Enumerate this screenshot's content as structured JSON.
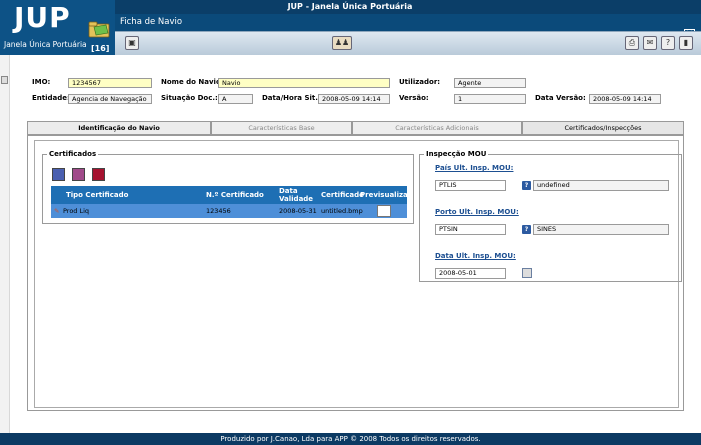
{
  "header": {
    "logo": "JUP",
    "logo_subtitle": "Janela Única Portuária",
    "inbox_count": "[16]",
    "app_title": "JUP - Janela Única Portuária",
    "form_title": "Ficha de Navio"
  },
  "fields": {
    "imo": {
      "label": "IMO:",
      "value": "1234567"
    },
    "nome_navio": {
      "label": "Nome do Navio:",
      "value": "Navio"
    },
    "utilizador": {
      "label": "Utilizador:",
      "value": "Agente"
    },
    "entidade": {
      "label": "Entidade:",
      "value": "Agencia de Navegação"
    },
    "situacao_doc": {
      "label": "Situação Doc.:",
      "value": "A"
    },
    "data_hora_sit": {
      "label": "Data/Hora Sit.:",
      "value": "2008-05-09 14:14"
    },
    "versao": {
      "label": "Versão:",
      "value": "1"
    },
    "data_versao": {
      "label": "Data Versão:",
      "value": "2008-05-09 14:14"
    }
  },
  "tabs": [
    {
      "label": "Identificação do Navio"
    },
    {
      "label": "Características Base"
    },
    {
      "label": "Características Adicionais"
    },
    {
      "label": "Certificados/Inspecções"
    }
  ],
  "certificados": {
    "legend": "Certificados",
    "columns": [
      "Tipo Certificado",
      "N.º Certificado",
      "Data Validade",
      "Certificado",
      "Previsualizar"
    ],
    "rows": [
      {
        "tipo": "Prod Liq",
        "numero": "123456",
        "validade": "2008-05-31",
        "certificado": "untitled.bmp"
      }
    ]
  },
  "inspeccao": {
    "legend": "Inspecção MOU",
    "pais_label": "País Ult. Insp. MOU:",
    "pais_code": "PTLIS",
    "pais_desc": "undefined",
    "porto_label": "Porto Ult. Insp. MOU:",
    "porto_code": "PTSIN",
    "porto_desc": "SINES",
    "data_label": "Data Ult. Insp. MOU:",
    "data_value": "2008-05-01",
    "help_glyph": "?"
  },
  "footer": {
    "text": "Produzido por J.Canao, Lda para APP © 2008 Todos os direitos reservados."
  },
  "colors": {
    "header_bg": "#0b4a7a",
    "table_header": "#1e6fb4",
    "selected_row": "#4e8fd8",
    "field_highlight": "#ffffc4"
  }
}
